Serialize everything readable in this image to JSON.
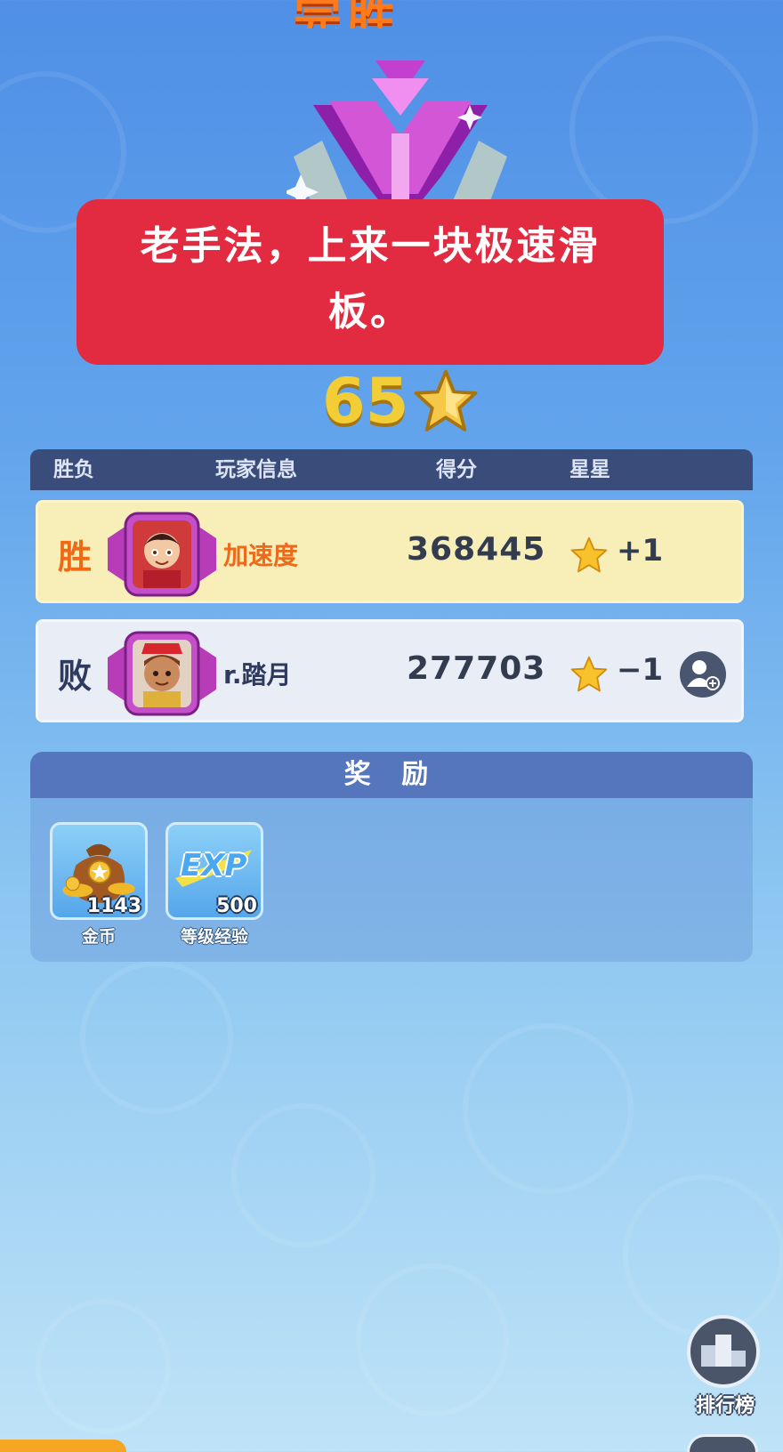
{
  "header": {
    "title": "完胜"
  },
  "overlay_caption": {
    "line1": "老手法，上来一块极速滑",
    "line2": "板。"
  },
  "rank": {
    "stars": "65",
    "icon": "star-icon"
  },
  "table": {
    "headers": {
      "result": "胜负",
      "player": "玩家信息",
      "score": "得分",
      "stars": "星星"
    },
    "rows": [
      {
        "result": "胜",
        "name": "加速度",
        "score": "368445",
        "delta": "+1",
        "outcome_color": "#f06a16"
      },
      {
        "result": "败",
        "name": "r.踏月",
        "score": "277703",
        "delta": "−1",
        "outcome_color": "#2e3a5e"
      }
    ]
  },
  "rewards": {
    "title": "奖 励",
    "items": [
      {
        "count": "1143",
        "label": "金币",
        "icon": "coin-bag-icon"
      },
      {
        "count": "500",
        "label": "等级经验",
        "icon_text": "EXP",
        "icon": "exp-icon"
      }
    ]
  },
  "leaderboard": {
    "label": "排行榜",
    "icon": "podium-icon"
  },
  "colors": {
    "accent": "#e22a41",
    "gold": "#f2cd35",
    "panel": "#3a4c7a"
  }
}
